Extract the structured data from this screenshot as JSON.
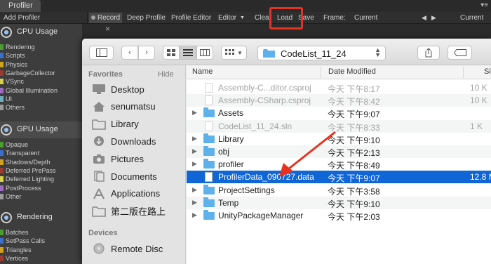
{
  "unity": {
    "tab_title": "Profiler",
    "tab_menu_glyph": "▾≡",
    "toolbar": {
      "add_profiler": "Add Profiler",
      "record": "Record",
      "deep_profile": "Deep Profile",
      "profiler_editor": "Profile Editor",
      "editor": "Editor",
      "clear": "Clear",
      "load": "Load",
      "save": "Save",
      "frame_label": "Frame:",
      "frame_value": "Current",
      "current_button": "Current"
    },
    "close_glyph": "×",
    "sections": [
      {
        "title": "CPU Usage",
        "legend": [
          "Rendering",
          "Scripts",
          "Physics",
          "GarbageCollector",
          "VSync",
          "Global Illumination",
          "UI",
          "Others"
        ],
        "colors": [
          "#4a9e2e",
          "#3a6fd0",
          "#d1a21c",
          "#9b3a2e",
          "#d8d04a",
          "#9b6cbf",
          "#6cb0c0",
          "#9b9b9b"
        ]
      },
      {
        "title": "GPU Usage",
        "legend": [
          "Opaque",
          "Transparent",
          "Shadows/Depth",
          "Deferred PrePass",
          "Deferred Lighting",
          "PostProcess",
          "Other"
        ],
        "colors": [
          "#4a9e2e",
          "#3a6fd0",
          "#d1a21c",
          "#9b3a2e",
          "#d8d04a",
          "#9b6cbf",
          "#9b9b9b"
        ]
      },
      {
        "title": "Rendering",
        "legend": [
          "Batches",
          "SetPass Calls",
          "Triangles",
          "Vertices"
        ],
        "colors": [
          "#4a9e2e",
          "#3a6fd0",
          "#d1a21c",
          "#9b3a2e"
        ]
      }
    ]
  },
  "dialog": {
    "path": "CodeList_11_24",
    "sidebar": {
      "favorites_label": "Favorites",
      "hide_label": "Hide",
      "devices_label": "Devices",
      "items": [
        {
          "label": "Desktop",
          "icon": "desktop-icon"
        },
        {
          "label": "senumatsu",
          "icon": "home-icon"
        },
        {
          "label": "Library",
          "icon": "folder-icon"
        },
        {
          "label": "Downloads",
          "icon": "downloads-icon"
        },
        {
          "label": "Pictures",
          "icon": "camera-icon"
        },
        {
          "label": "Documents",
          "icon": "documents-icon"
        },
        {
          "label": "Applications",
          "icon": "applications-icon"
        },
        {
          "label": "第二版在路上",
          "icon": "folder-icon"
        }
      ],
      "devices": [
        {
          "label": "Remote Disc",
          "icon": "disc-icon"
        }
      ]
    },
    "columns": {
      "name": "Name",
      "date": "Date Modified",
      "size": "Siz"
    },
    "rows": [
      {
        "name": "Assembly-C...ditor.csproj",
        "date": "今天 下午8:17",
        "size": "10 K",
        "kind": "file",
        "disabled": true,
        "expandable": false,
        "selected": false
      },
      {
        "name": "Assembly-CSharp.csproj",
        "date": "今天 下午8:42",
        "size": "10 K",
        "kind": "file",
        "disabled": true,
        "expandable": false,
        "selected": false
      },
      {
        "name": "Assets",
        "date": "今天 下午9:07",
        "size": "",
        "kind": "folder",
        "disabled": false,
        "expandable": true,
        "selected": false
      },
      {
        "name": "CodeList_11_24.sln",
        "date": "今天 下午8:33",
        "size": "1 K",
        "kind": "file",
        "disabled": true,
        "expandable": false,
        "selected": false
      },
      {
        "name": "Library",
        "date": "今天 下午9:10",
        "size": "",
        "kind": "folder",
        "disabled": false,
        "expandable": true,
        "selected": false
      },
      {
        "name": "obj",
        "date": "今天 下午2:13",
        "size": "",
        "kind": "folder",
        "disabled": false,
        "expandable": true,
        "selected": false
      },
      {
        "name": "profiler",
        "date": "今天 下午8:49",
        "size": "",
        "kind": "folder",
        "disabled": false,
        "expandable": true,
        "selected": false
      },
      {
        "name": "ProfilerData_090727.data",
        "date": "今天 下午9:07",
        "size": "12.8 M",
        "kind": "file",
        "disabled": false,
        "expandable": false,
        "selected": true
      },
      {
        "name": "ProjectSettings",
        "date": "今天 下午3:58",
        "size": "",
        "kind": "folder",
        "disabled": false,
        "expandable": true,
        "selected": false
      },
      {
        "name": "Temp",
        "date": "今天 下午9:10",
        "size": "",
        "kind": "folder",
        "disabled": false,
        "expandable": true,
        "selected": false
      },
      {
        "name": "UnityPackageManager",
        "date": "今天 下午2:03",
        "size": "",
        "kind": "folder",
        "disabled": false,
        "expandable": true,
        "selected": false
      }
    ]
  },
  "colors": {
    "selection": "#1066d6",
    "folder": "#5fb1ec",
    "annotation": "#e8321f"
  }
}
